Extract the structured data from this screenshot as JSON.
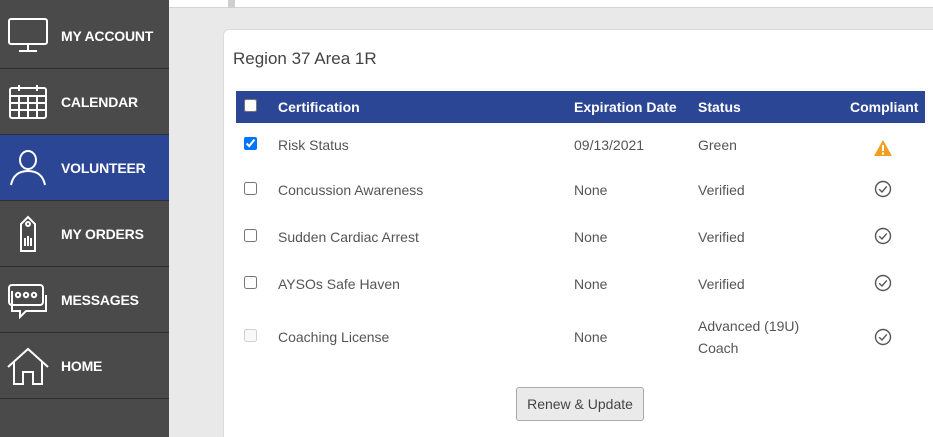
{
  "sidebar": {
    "items": [
      {
        "label": "MY ACCOUNT",
        "icon": "monitor-icon"
      },
      {
        "label": "CALENDAR",
        "icon": "calendar-icon"
      },
      {
        "label": "VOLUNTEER",
        "icon": "person-icon",
        "active": true
      },
      {
        "label": "MY ORDERS",
        "icon": "tag-icon"
      },
      {
        "label": "MESSAGES",
        "icon": "chat-icon"
      },
      {
        "label": "HOME",
        "icon": "home-icon"
      }
    ]
  },
  "card": {
    "title": "Region 37 Area 1R"
  },
  "table": {
    "headers": {
      "certification": "Certification",
      "expiration": "Expiration Date",
      "status": "Status",
      "compliant": "Compliant"
    },
    "rows": [
      {
        "certification": "Risk Status",
        "expiration": "09/13/2021",
        "status": "Green",
        "compliant_icon": "warning-icon",
        "checked": true,
        "disabled": false
      },
      {
        "certification": "Concussion Awareness",
        "expiration": "None",
        "status": "Verified",
        "compliant_icon": "check-circle-icon",
        "checked": false,
        "disabled": false
      },
      {
        "certification": "Sudden Cardiac Arrest",
        "expiration": "None",
        "status": "Verified",
        "compliant_icon": "check-circle-icon",
        "checked": false,
        "disabled": false
      },
      {
        "certification": "AYSOs Safe Haven",
        "expiration": "None",
        "status": "Verified",
        "compliant_icon": "check-circle-icon",
        "checked": false,
        "disabled": false
      },
      {
        "certification": "Coaching License",
        "expiration": "None",
        "status_line1": "Advanced (19U)",
        "status_line2": "Coach",
        "compliant_icon": "check-circle-icon",
        "checked": false,
        "disabled": true
      }
    ]
  },
  "actions": {
    "renew_label": "Renew & Update"
  },
  "colors": {
    "sidebar_bg": "#4a4a4a",
    "accent": "#2c4696",
    "warning": "#f0a020"
  }
}
